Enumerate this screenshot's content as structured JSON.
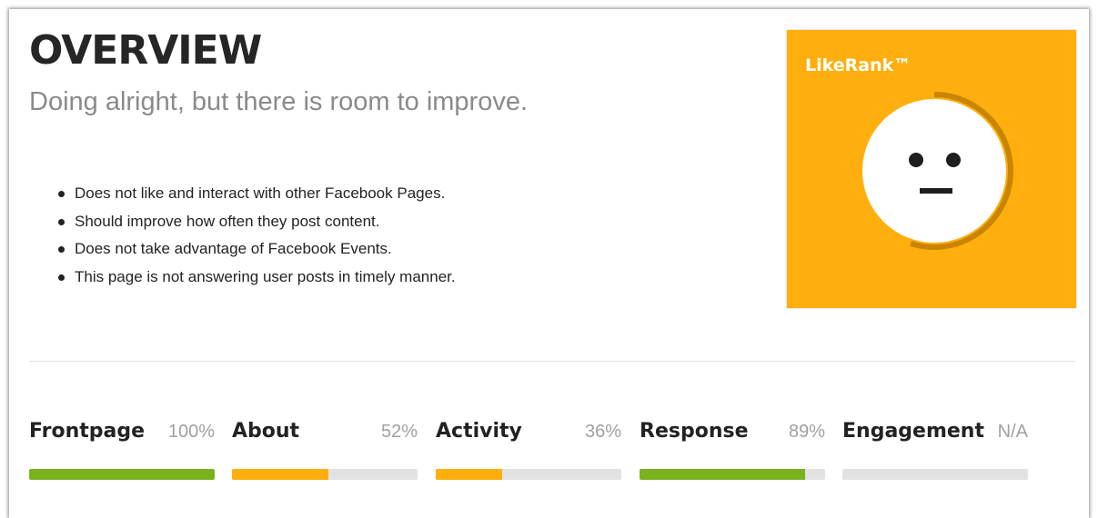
{
  "overview": {
    "title": "OVERVIEW",
    "subtitle": "Doing alright, but there is room to improve.",
    "bullets": [
      "Does not like and interact with other Facebook Pages.",
      "Should improve how often they post content.",
      "Does not take advantage of Facebook Events.",
      "This page is not answering user posts in timely manner."
    ]
  },
  "likerank": {
    "title": "LikeRank™",
    "face": "neutral-face",
    "background_color": "#ffaf0d",
    "ring_color": "#c98400",
    "ring_fraction": 0.55
  },
  "metrics": [
    {
      "label": "Frontpage",
      "value": "100%",
      "fraction": 1.0,
      "color": "#79b21c"
    },
    {
      "label": "About",
      "value": "52%",
      "fraction": 0.52,
      "color": "#ffaf0d"
    },
    {
      "label": "Activity",
      "value": "36%",
      "fraction": 0.36,
      "color": "#ffaf0d"
    },
    {
      "label": "Response",
      "value": "89%",
      "fraction": 0.89,
      "color": "#79b21c"
    },
    {
      "label": "Engagement",
      "value": "N/A",
      "fraction": 0,
      "color": "#e2e2e2"
    }
  ]
}
